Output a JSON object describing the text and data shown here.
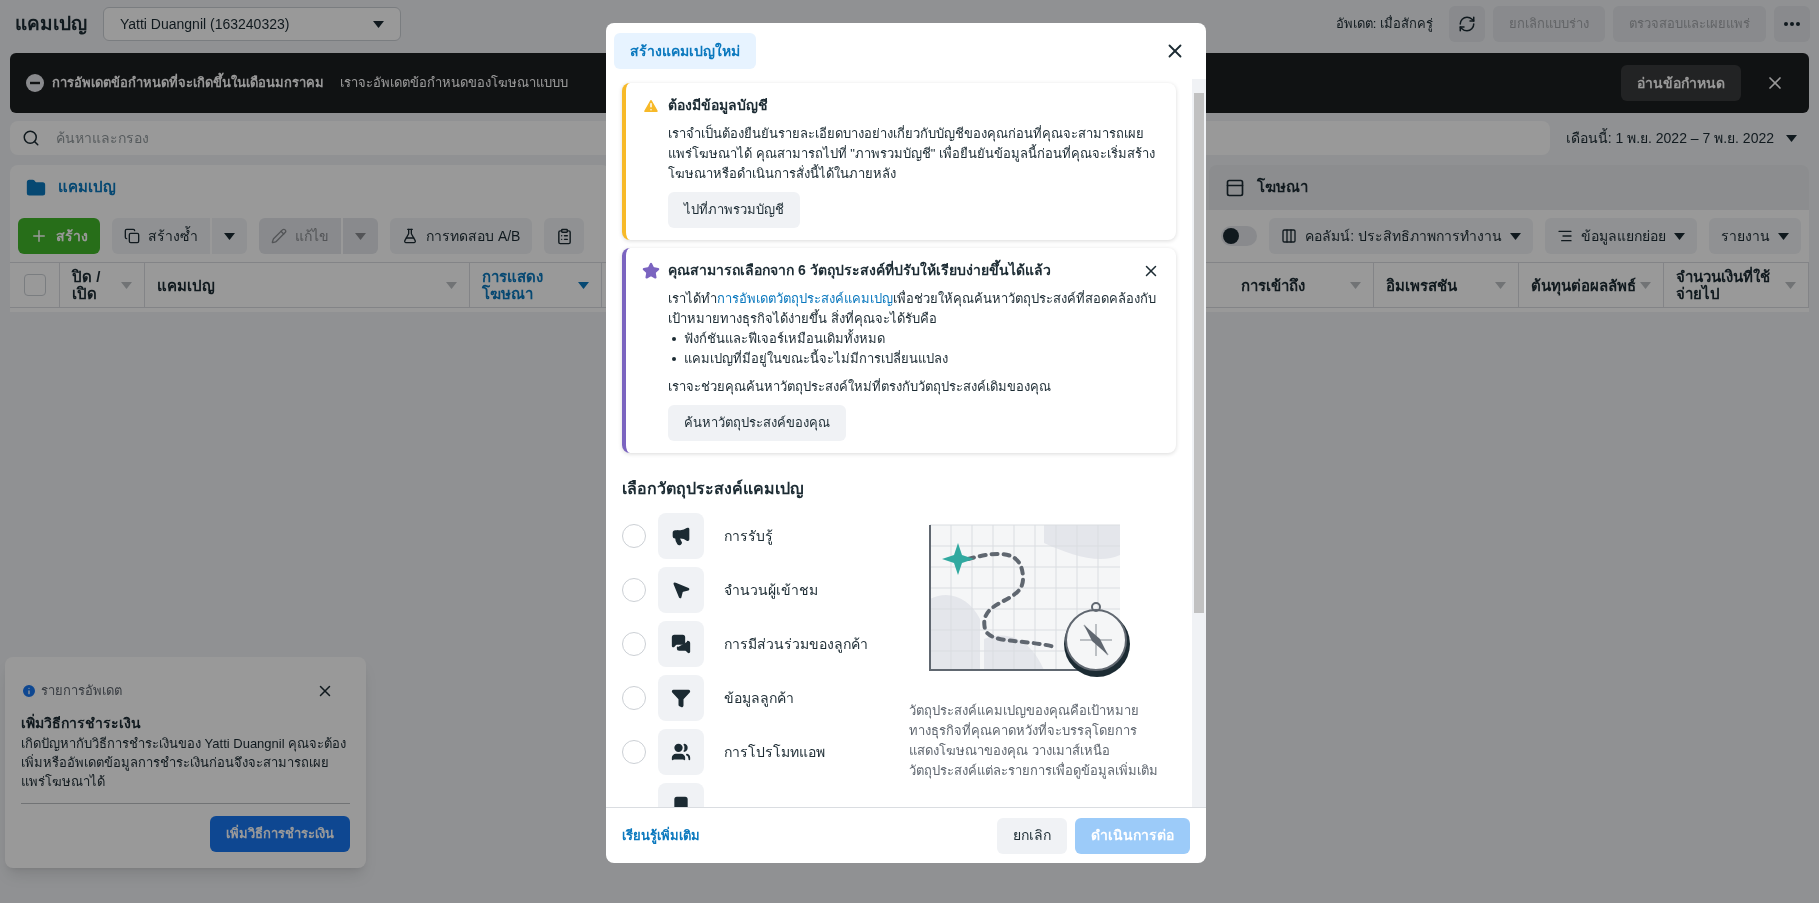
{
  "top_bar": {
    "title": "แคมเปญ",
    "account": "Yatti Duangnil (163240323)",
    "update_status": "อัพเดต: เมื่อสักครู่",
    "buttons": [
      {
        "label": "ยกเลิกแบบร่าง",
        "disabled": true
      },
      {
        "label": "ตรวจสอบและเผยแพร่",
        "disabled": true
      }
    ]
  },
  "banner": {
    "title": "การอัพเดตข้อกำหนดที่จะเกิดขึ้นในเดือนมกราคม",
    "text": "เราจะอัพเดตข้อกำหนดของโฆษณาแบบบ",
    "button": "อ่านข้อกำหนด"
  },
  "search": {
    "placeholder": "ค้นหาและกรอง"
  },
  "date_range": "เดือนนี้: 1 พ.ย. 2022 – 7 พ.ย. 2022",
  "level_tabs": [
    {
      "label": "แคมเปญ",
      "selected": true
    },
    {
      "label": "โฆษณา",
      "selected": false
    }
  ],
  "toolbar": [
    {
      "kind": "primary",
      "label": "สร้าง",
      "disabled": false
    },
    {
      "kind": "split",
      "label": "สร้างซ้ำ",
      "disabled": false
    },
    {
      "kind": "split",
      "label": "แก้ไข",
      "disabled": true
    },
    {
      "kind": "plain",
      "label": "การทดสอบ A/B",
      "disabled": false
    },
    {
      "kind": "icon",
      "disabled": false
    }
  ],
  "toolbar_right": {
    "toggle": {
      "on": false
    },
    "menus": [
      "คอลัมน์: ประสิทธิภาพการทำงาน",
      "ข้อมูลแยกย่อย",
      "รายงาน"
    ]
  },
  "table": {
    "select_all": {
      "checked": false
    },
    "columns_left": [
      {
        "label": "ปิด / เปิด",
        "sorted": false
      },
      {
        "label": "แคมเปญ",
        "sorted": false
      },
      {
        "label": "การแสดงโฆษณา",
        "sorted": true
      }
    ],
    "columns_right": [
      {
        "label": "การเข้าถึง",
        "sorted": false
      },
      {
        "label": "อิมเพรสชัน",
        "sorted": false
      },
      {
        "label": "ต้นทุนต่อผลลัพธ์",
        "sorted": false
      },
      {
        "label": "จำนวนเงินที่ใช้จ่ายไป",
        "sorted": false
      }
    ]
  },
  "notification": {
    "category": "รายการอัพเดต",
    "title": "เพิ่มวิธีการชำระเงิน",
    "text": "เกิดปัญหากับวิธีการชำระเงินของ Yatti Duangnil คุณจะต้องเพิ่มหรืออัพเดตข้อมูลการชำระเงินก่อนจึงจะสามารถเผยแพร่โฆษณาได้",
    "button": "เพิ่มวิธีการชำระเงิน"
  },
  "modal": {
    "tab": "สร้างแคมเปญใหม่",
    "notices": [
      {
        "kind": "warning",
        "title": "ต้องมีข้อมูลบัญชี",
        "dismissible": false,
        "body": "เราจำเป็นต้องยืนยันรายละเอียดบางอย่างเกี่ยวกับบัญชีของคุณก่อนที่คุณจะสามารถเผยแพร่โฆษณาได้ คุณสามารถไปที่ \"ภาพรวมบัญชี\" เพื่อยืนยันข้อมูลนี้ก่อนที่คุณจะเริ่มสร้างโฆษณาหรือดำเนินการสั่งนี้ได้ในภายหลัง",
        "button": "ไปที่ภาพรวมบัญชี"
      },
      {
        "kind": "info",
        "title": "คุณสามารถเลือกจาก 6 วัตถุประสงค์ที่ปรับให้เรียบง่ายขึ้นได้แล้ว",
        "dismissible": true,
        "body_before": "เราได้ทำ",
        "link": "การอัพเดตวัตถุประสงค์แคมเปญ",
        "body_after": "เพื่อช่วยให้คุณค้นหาวัตถุประสงค์ที่สอดคล้องกับเป้าหมายทางธุรกิจได้ง่ายขึ้น สิ่งที่คุณจะได้รับคือ",
        "bullets": [
          "ฟังก์ชันและฟีเจอร์เหมือนเดิมทั้งหมด",
          "แคมเปญที่มีอยู่ในขณะนี้จะไม่มีการเปลี่ยนแปลง"
        ],
        "note": "เราจะช่วยคุณค้นหาวัตถุประสงค์ใหม่ที่ตรงกับวัตถุประสงค์เดิมของคุณ",
        "button": "ค้นหาวัตถุประสงค์ของคุณ"
      }
    ],
    "objectives_title": "เลือกวัตถุประสงค์แคมเปญ",
    "objectives": [
      {
        "label": "การรับรู้",
        "selected": false
      },
      {
        "label": "จำนวนผู้เข้าชม",
        "selected": false
      },
      {
        "label": "การมีส่วนร่วมของลูกค้า",
        "selected": false
      },
      {
        "label": "ข้อมูลลูกค้า",
        "selected": false
      },
      {
        "label": "การโปรโมทแอพ",
        "selected": false
      },
      {
        "kind": "partial"
      }
    ],
    "description": "วัตถุประสงค์แคมเปญของคุณคือเป้าหมายทางธุรกิจที่คุณคาดหวังที่จะบรรลุโดยการแสดงโฆษณาของคุณ วางเมาส์เหนือวัตถุประสงค์แต่ละรายการเพื่อดูข้อมูลเพิ่มเติม",
    "learn_more": "เรียนรู้เพิ่มเติม",
    "cancel": "ยกเลิก",
    "continue": {
      "label": "ดำเนินการต่อ",
      "disabled": true
    }
  }
}
